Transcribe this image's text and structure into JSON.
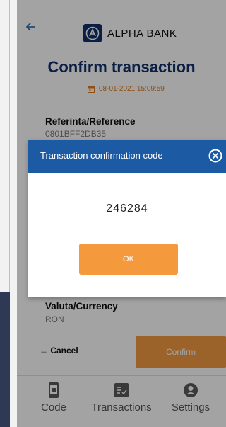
{
  "header": {
    "brand": "ALPHA BANK",
    "title": "Confirm transaction",
    "datetime": "08-01-2021 15:09:59"
  },
  "fields": [
    {
      "label": "Referinta/Reference",
      "value": "0801BFF2DB35"
    },
    {
      "label": "Valuta/Currency",
      "value": "RON"
    }
  ],
  "actions": {
    "cancel_label": "← Cancel",
    "confirm_label": "Confirm"
  },
  "modal": {
    "title": "Transaction confirmation code",
    "code": "246284",
    "ok_label": "OK"
  },
  "nav": [
    {
      "label": "Code"
    },
    {
      "label": "Transactions"
    },
    {
      "label": "Settings"
    }
  ],
  "colors": {
    "brand_blue": "#12306b",
    "modal_header": "#1c5ba3",
    "accent_orange": "#f29a40"
  }
}
